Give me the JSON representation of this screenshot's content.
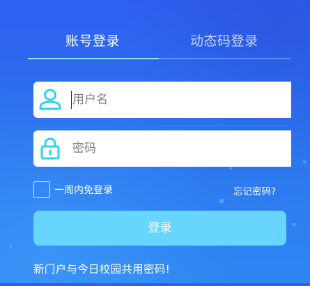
{
  "tabs": {
    "account_login": "账号登录",
    "dynamic_code_login": "动态码登录"
  },
  "form": {
    "username_placeholder": "用户名",
    "password_placeholder": "密码",
    "remember_label": "一周内免登录",
    "forgot_label": "忘记密码?",
    "login_button": "登录"
  },
  "footer": {
    "note": "新门户与今日校园共用密码!"
  },
  "colors": {
    "accent_cyan": "#66d6ff",
    "icon_cyan": "#2ad3f0",
    "tab_underline_active": "#8fe6ff",
    "background_top": "#2f5ff0",
    "background_bottom": "#2f86f2"
  },
  "icons": {
    "username": "user-icon",
    "password": "lock-icon"
  }
}
